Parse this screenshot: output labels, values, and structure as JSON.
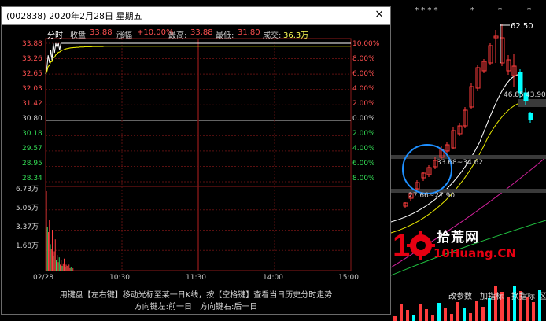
{
  "window": {
    "title": "(002838) 2020年2月28日 星期五",
    "close": "×"
  },
  "info": {
    "mode": "分时",
    "close_label": "收盘",
    "close_value": "33.88",
    "change_label": "涨幅",
    "change_value": "+10.00%",
    "high_label": "最高:",
    "high_value": "33.88",
    "low_label": "最低:",
    "low_value": "31.80",
    "volume_label": "成交:",
    "volume_value": "36.3万"
  },
  "price_axis": {
    "left": [
      "33.88",
      "33.26",
      "32.65",
      "32.03",
      "31.42",
      "30.80",
      "30.18",
      "29.57",
      "28.95",
      "28.34"
    ],
    "right": [
      "10.00%",
      "8.00%",
      "6.00%",
      "4.00%",
      "2.00%",
      "0.00%",
      "2.00%",
      "4.00%",
      "6.00%",
      "8.00%"
    ]
  },
  "volume_axis": [
    "6.73万",
    "5.05万",
    "3.37万",
    "1.68万"
  ],
  "time_axis": [
    "02/28",
    "10:30",
    "11:30",
    "14:00",
    "15:00"
  ],
  "help": {
    "line1": "用键盘【左右键】移动光标至某一日K线，按【空格键】查看当日历史分时走势",
    "line2": "方向键左:前一日　方向键右:后一日"
  },
  "main_chart": {
    "stars": "* * * *",
    "high_label": "62.50",
    "label_a": "46.85",
    "label_b": "43.90",
    "range_a": "33.68~34.62",
    "range_b": "27.66~27.90"
  },
  "watermark": {
    "brand_cn": "拾荒网",
    "brand_en": "10Huang.CN"
  },
  "bottom_tabs": [
    "改参数",
    "加指标",
    "换指标",
    "区"
  ],
  "colors": {
    "up": "#ff3c3c",
    "down": "#00ffff",
    "price_line": "#ffffff",
    "avg_line": "#ffff00",
    "accent_red": "#e60012"
  },
  "chart_data": {
    "type": "line",
    "title": "",
    "xlabel": "",
    "ylabel": "",
    "prev_close": 30.8,
    "ylim": [
      28.34,
      33.88
    ],
    "x_ticks": [
      "02/28",
      "10:30",
      "11:30",
      "14:00",
      "15:00"
    ],
    "series": [
      {
        "values": [
          32.65,
          32.9,
          33.4,
          33.1,
          33.6,
          33.2,
          33.88,
          33.5,
          33.88,
          33.7,
          33.88,
          33.6,
          33.88,
          33.88,
          33.88,
          33.88,
          33.88,
          33.88,
          33.88,
          33.88,
          33.88,
          33.88,
          33.88,
          33.88,
          33.88,
          33.88,
          33.88,
          33.88,
          33.88,
          33.88,
          33.88,
          33.88,
          33.88,
          33.88,
          33.88,
          33.88,
          33.88,
          33.88,
          33.88,
          33.88,
          33.88,
          33.88,
          33.88,
          33.88,
          33.88,
          33.88,
          33.88,
          33.88,
          33.88,
          33.88
        ]
      },
      {
        "values": [
          32.65,
          32.75,
          32.95,
          33.0,
          33.15,
          33.15,
          33.3,
          33.32,
          33.42,
          33.45,
          33.52,
          33.53,
          33.58,
          33.6,
          33.62,
          33.64,
          33.66,
          33.67,
          33.68,
          33.69,
          33.7,
          33.7,
          33.71,
          33.71,
          33.72,
          33.72,
          33.72,
          33.73,
          33.73,
          33.73,
          33.73,
          33.74,
          33.74,
          33.74,
          33.74,
          33.74,
          33.74,
          33.75,
          33.75,
          33.75,
          33.75,
          33.75,
          33.75,
          33.75,
          33.75,
          33.75,
          33.76,
          33.76,
          33.76,
          33.76
        ]
      }
    ],
    "volume": {
      "ylim": [
        0,
        6.73
      ],
      "values": [
        6.6,
        3.6,
        3.2,
        4.2,
        2.2,
        1.8,
        3.4,
        1.2,
        1.6,
        2.6,
        0.9,
        1.3,
        0.7,
        1.1,
        0.5,
        0.9,
        0.4,
        0.6,
        1.0,
        0.3,
        0.5,
        0.4,
        0.3,
        0.5,
        0.2,
        0.3,
        0.4,
        0.2
      ]
    }
  }
}
